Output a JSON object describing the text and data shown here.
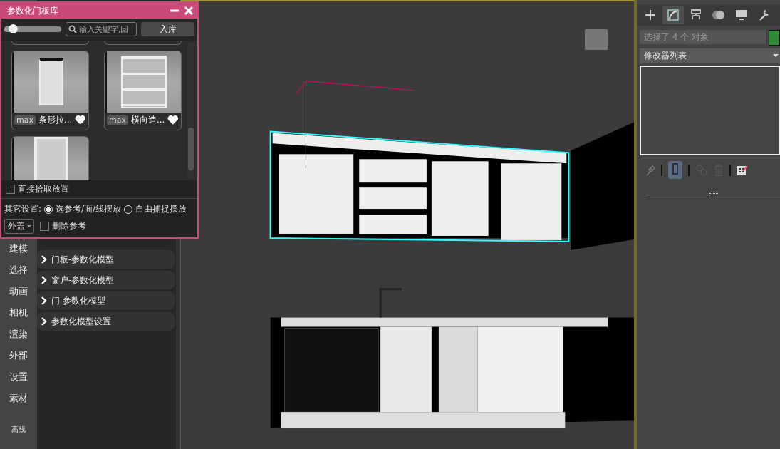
{
  "floating_panel": {
    "title": "参数化门板库",
    "toolbar": {
      "size_slider": {
        "level": 0.15
      },
      "search": {
        "placeholder": "输入关键字,回"
      },
      "add_button": "入库"
    },
    "cards": [
      {
        "kind": "partial"
      },
      {
        "kind": "partial"
      },
      {
        "kind": "full",
        "badge": "max",
        "name": "条形拉..."
      },
      {
        "kind": "full",
        "badge": "max",
        "name": "横向造..."
      },
      {
        "kind": "cut"
      }
    ],
    "direct_pick": {
      "label": "直接拾取放置",
      "checked": false
    },
    "other_settings": {
      "label": "其它设置:",
      "options": [
        {
          "label": "选参考/面/线摆放",
          "selected": true
        },
        {
          "label": "自由捕捉摆放",
          "selected": false
        }
      ]
    },
    "mode_dropdown": "外盖",
    "delete_reference": {
      "label": "删除参考",
      "checked": false
    }
  },
  "side_nav": [
    {
      "label": "建模"
    },
    {
      "label": "选择"
    },
    {
      "label": "动画"
    },
    {
      "label": "相机"
    },
    {
      "label": "渲染"
    },
    {
      "label": "外部"
    },
    {
      "label": "设置"
    },
    {
      "label": "素材"
    },
    {
      "label": "高线"
    }
  ],
  "rollouts": [
    {
      "label": "门板-参数化模型"
    },
    {
      "label": "窗户-参数化模型"
    },
    {
      "label": "门-参数化模型"
    },
    {
      "label": "参数化模型设置"
    }
  ],
  "command_panel": {
    "tabs": [
      {
        "selected": false
      },
      {
        "selected": true
      },
      {
        "selected": false
      },
      {
        "selected": false
      },
      {
        "selected": false
      },
      {
        "selected": false
      }
    ],
    "selection_field": "选择了 4 个 对象",
    "modifier_list": "修改器列表"
  }
}
